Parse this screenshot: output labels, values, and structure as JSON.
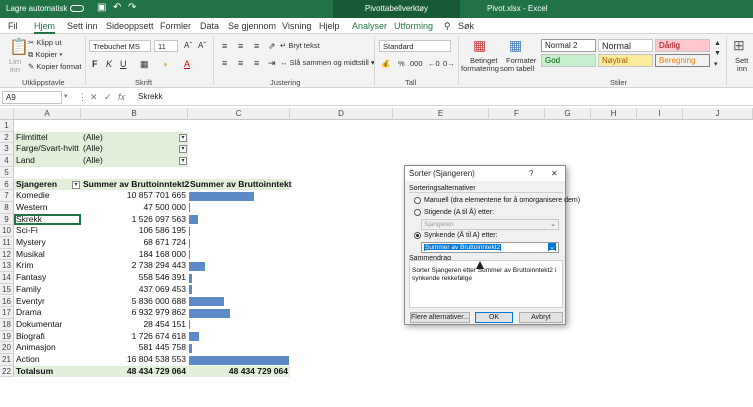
{
  "titlebar": {
    "autosave": "Lagre automatisk",
    "toggle": "Av",
    "undo_icon": "undo-icon",
    "redo_icon": "redo-icon",
    "pivot_tools": "Pivottabellverktøy",
    "filename": "Pivot.xlsx - Excel"
  },
  "menu": [
    "Fil",
    "Hjem",
    "Sett inn",
    "Sideoppsett",
    "Formler",
    "Data",
    "Se gjennom",
    "Visning",
    "Hjelp",
    "Analyser",
    "Utforming",
    "Søk"
  ],
  "ribbon": {
    "clipboard": {
      "paste": "Lim",
      "paste2": "inn",
      "cut": "Klipp ut",
      "copy": "Kopier",
      "format_painter": "Kopier format",
      "label": "Utklippstavle"
    },
    "font": {
      "name": "Trebuchet MS",
      "size": "11",
      "label": "Skrift",
      "bold": "F",
      "italic": "K",
      "underline": "U",
      "color_a": "A"
    },
    "alignment": {
      "wrap": "Bryt tekst",
      "merge": "Slå sammen og midtstill",
      "label": "Justering"
    },
    "number": {
      "format": "Standard",
      "percent": "%",
      "comma": "000",
      "label": "Tall"
    },
    "styles": {
      "cond": "Betinget",
      "cond2": "formatering",
      "table": "Formater",
      "table2": "som tabell",
      "normal2": "Normal 2",
      "normal": "Normal",
      "bad": "Dårlig",
      "good": "God",
      "neutral": "Nøytral",
      "calc": "Beregning",
      "label": "Stiler"
    },
    "insert": {
      "label": "Sett",
      "label2": "inn"
    }
  },
  "formula": {
    "namebox": "A9",
    "fx": "fx",
    "content": "Skrekk"
  },
  "columns": [
    "A",
    "B",
    "C",
    "D",
    "E",
    "F",
    "G",
    "H",
    "I",
    "J"
  ],
  "rows": [
    "1",
    "2",
    "3",
    "4",
    "5",
    "6",
    "7",
    "8",
    "9",
    "10",
    "11",
    "12",
    "13",
    "14",
    "15",
    "16",
    "17",
    "18",
    "19",
    "20",
    "21",
    "22"
  ],
  "filters": [
    {
      "label": "Filmtittel",
      "value": "(Alle)"
    },
    {
      "label": "Farge/Svart-hvitt",
      "value": "(Alle)"
    },
    {
      "label": "Land",
      "value": "(Alle)"
    }
  ],
  "pivot_header": {
    "genre": "Sjangeren",
    "sum2": "Summer av Bruttoinntekt2",
    "sum": "Summer av Bruttoinntekt"
  },
  "pivot_rows": [
    {
      "genre": "Komedie",
      "value": "10 857 701 665"
    },
    {
      "genre": "Western",
      "value": "47 500 000"
    },
    {
      "genre": "Skrekk",
      "value": "1 526 097 563"
    },
    {
      "genre": "Sci-Fi",
      "value": "106 586 195"
    },
    {
      "genre": "Mystery",
      "value": "68 671 724"
    },
    {
      "genre": "Musikal",
      "value": "184 168 000"
    },
    {
      "genre": "Krim",
      "value": "2 738 294 443"
    },
    {
      "genre": "Fantasy",
      "value": "558 546 391"
    },
    {
      "genre": "Family",
      "value": "437 069 453"
    },
    {
      "genre": "Eventyr",
      "value": "5 836 000 688"
    },
    {
      "genre": "Drama",
      "value": "6 932 979 862"
    },
    {
      "genre": "Dokumentar",
      "value": "28 454 151"
    },
    {
      "genre": "Biografi",
      "value": "1 726 674 618"
    },
    {
      "genre": "Animasjon",
      "value": "581 445 758"
    },
    {
      "genre": "Action",
      "value": "16 804 538 553"
    }
  ],
  "bar_values": [
    10857701665,
    47500000,
    1526097563,
    106586195,
    68671724,
    184168000,
    2738294443,
    558546391,
    437069453,
    5836000688,
    6932979862,
    28454151,
    1726674618,
    581445758,
    16804538553
  ],
  "total": {
    "label": "Totalsum",
    "value2": "48 434 729 064",
    "value": "48 434 729 064"
  },
  "dialog": {
    "title": "Sorter (Sjangeren)",
    "help": "?",
    "close": "✕",
    "options_header": "Sorteringsalternativer",
    "manual": "Manuell (dra elementene for å omorganisere dem)",
    "ascending": "Stigende (A til Å) etter:",
    "ascending_value": "Sjangeren",
    "descending": "Synkende (Å til A) etter:",
    "descending_value": "Summer av Bruttoinntekt2",
    "summary_header": "Sammendrag",
    "summary_text1": "Sorter Sjangeren etter Summer av Bruttoinntekt2 i",
    "summary_text2": "synkende rekkefølge",
    "more_button": "Flere alternativer...",
    "ok_button": "OK",
    "cancel_button": "Avbryt"
  }
}
